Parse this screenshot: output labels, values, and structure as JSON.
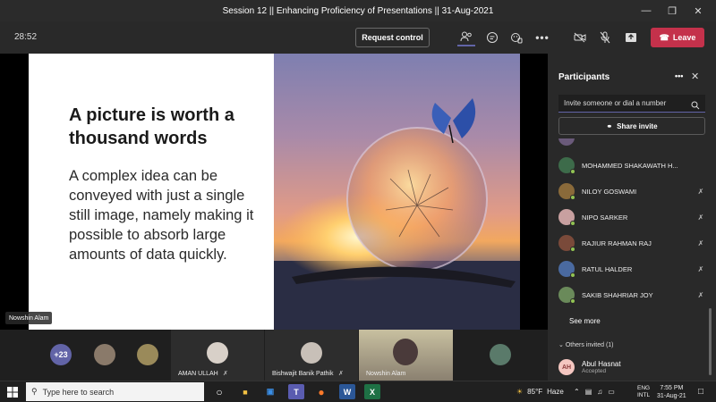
{
  "window": {
    "title": "Session 12 || Enhancing Proficiency of Presentations || 31-Aug-2021"
  },
  "toolbar": {
    "timer": "28:52",
    "request_control": "Request control",
    "leave": "Leave"
  },
  "slide": {
    "title": "A picture is worth a thousand words",
    "body": "A complex idea can be conveyed with just a single still image, namely making it possible to absorb large amounts of data quickly."
  },
  "presenter_tag": "Nowshin Alam",
  "gallery": {
    "overflow_count": "+23",
    "tiles": [
      {
        "name": "AMAN ULLAH"
      },
      {
        "name": "Bishwajit Banik Pathik"
      },
      {
        "name": "Nowshin Alam"
      }
    ]
  },
  "participants_panel": {
    "title": "Participants",
    "search_placeholder": "Invite someone or dial a number",
    "share_invite": "Share invite",
    "rows": [
      {
        "name": "MOHAMMED SHAKAWATH H...",
        "avatar_color": "#3d6b4a"
      },
      {
        "name": "NILOY GOSWAMI",
        "avatar_color": "#8a6a3a"
      },
      {
        "name": "NIPO SARKER",
        "avatar_color": "#c8a0a0"
      },
      {
        "name": "RAJIUR RAHMAN RAJ",
        "avatar_color": "#7a4a3a"
      },
      {
        "name": "RATUL HALDER",
        "avatar_color": "#4a6aa0"
      },
      {
        "name": "SAKIB SHAHRIAR JOY",
        "avatar_color": "#6a8a5a"
      }
    ],
    "see_more": "See more",
    "others_invited": "Others invited (1)",
    "invited": {
      "initials": "AH",
      "name": "Abul Hasnat",
      "status": "Accepted"
    }
  },
  "taskbar": {
    "search_placeholder": "Type here to search",
    "weather": "85°F",
    "weather_desc": "Haze",
    "lang": "ENG",
    "lang_sub": "INTL",
    "time": "7:55 PM",
    "date": "31-Aug-21"
  },
  "colors": {
    "accent": "#6264a7",
    "leave": "#c4314b",
    "presence": "#92c353"
  }
}
